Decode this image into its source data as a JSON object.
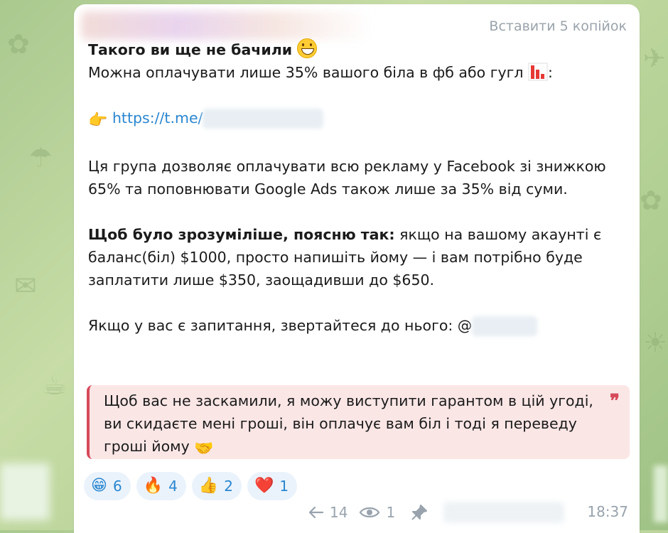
{
  "header": {
    "paste_button": "Вставити 5 копійок"
  },
  "message": {
    "headline": "Такого ви ще не бачили",
    "line2": "Можна оплачувати лише 35% вашого біла в фб або гугл",
    "line2_suffix": ":",
    "link_prefix": "https://t.me/",
    "para1": "Ця група дозволяє оплачувати всю рекламу у Facebook зі знижкою 65% та поповнювати Google Ads також лише за 35% від суми.",
    "para2_bold": "Щоб було зрозуміліше, поясню так:",
    "para2_rest": " якщо на вашому акаунті є баланс(біл) $1000, просто напишіть йому — і вам потрібно буде заплатити лише $350, заощадивши до $650.",
    "contact": "Якщо у вас є запитання, звертайтеся до нього: @",
    "quote": "Щоб вас не заскамили, я можу виступити гарантом в цій угоді, ви скидаєте мені гроші, він оплачує вам біл і тоді я переведу гроші йому"
  },
  "reactions": [
    {
      "emoji": "😁",
      "icon": "grin-icon",
      "count": "6"
    },
    {
      "emoji": "🔥",
      "icon": "fire-icon",
      "count": "4"
    },
    {
      "emoji": "👍",
      "icon": "thumbs-up-icon",
      "count": "2"
    },
    {
      "emoji": "❤️",
      "icon": "heart-icon",
      "count": "1"
    }
  ],
  "meta": {
    "forwards": "14",
    "views": "1",
    "time": "18:37"
  },
  "colors": {
    "accent": "#2a86d0",
    "quote_bar": "#d6495a",
    "quote_bg": "#fbe6e6",
    "meta": "#98a3ad"
  }
}
